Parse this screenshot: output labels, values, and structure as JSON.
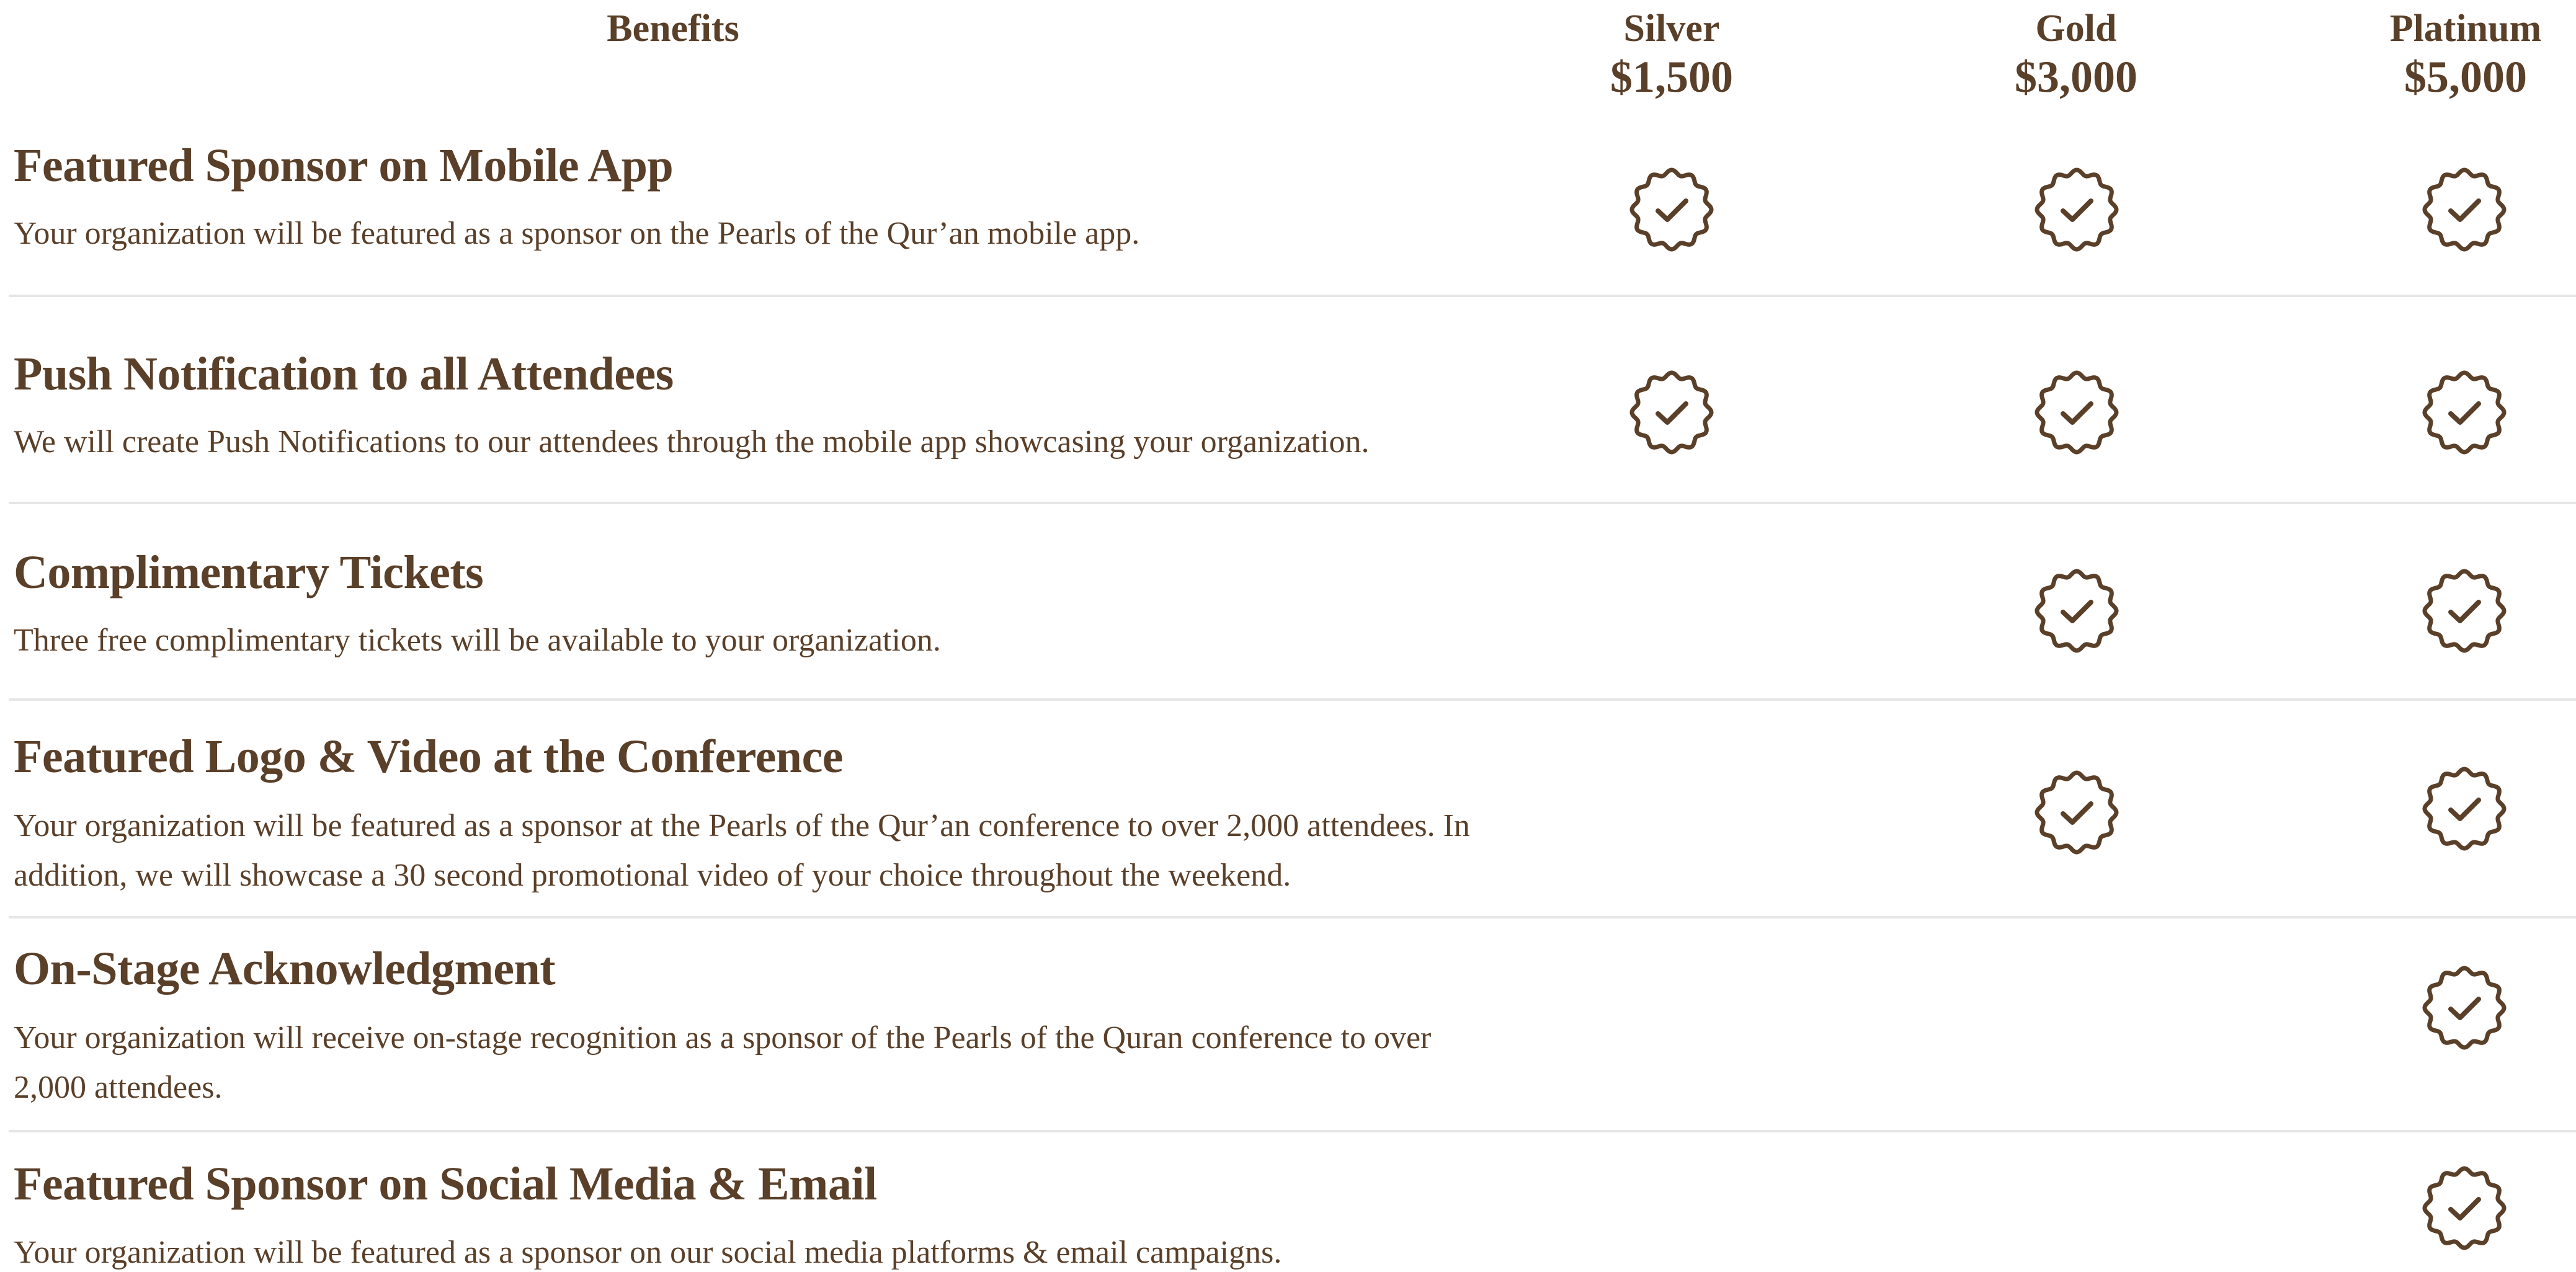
{
  "header": {
    "benefits_label": "Benefits",
    "tiers": [
      {
        "name": "Silver",
        "price": "$1,500"
      },
      {
        "name": "Gold",
        "price": "$3,000"
      },
      {
        "name": "Platinum",
        "price": "$5,000"
      }
    ]
  },
  "rows": [
    {
      "title": "Featured Sponsor on Mobile App",
      "description": "Your organization will be featured as a sponsor on the Pearls of the Qur’an mobile app.",
      "silver": true,
      "gold": true,
      "platinum": true
    },
    {
      "title": "Push Notification to all Attendees",
      "description": "We will create Push Notifications to our attendees through the mobile app showcasing your organization.",
      "silver": true,
      "gold": true,
      "platinum": true
    },
    {
      "title": "Complimentary Tickets",
      "description": "Three free complimentary tickets will be available to your organization.",
      "silver": false,
      "gold": true,
      "platinum": true
    },
    {
      "title": "Featured Logo & Video at the Conference",
      "description": "Your organization will be featured as a sponsor at the Pearls of the Qur’an conference to over 2,000 attendees. In addition, we will showcase a 30 second promotional video of your choice throughout the weekend.",
      "silver": false,
      "gold": true,
      "platinum": true
    },
    {
      "title": "On-Stage Acknowledgment",
      "description": "Your organization will receive on-stage recognition as a sponsor of the Pearls of the Quran conference to over 2,000 attendees.",
      "silver": false,
      "gold": false,
      "platinum": true
    },
    {
      "title": "Featured Sponsor on Social Media & Email",
      "description": "Your organization will be featured as a sponsor on our social media platforms & email campaigns.",
      "silver": false,
      "gold": false,
      "platinum": true
    }
  ],
  "colors": {
    "text": "#5a3f29",
    "divider": "#e6e6e6",
    "background": "#ffffff"
  },
  "icons": {
    "check": "badge-check-icon"
  }
}
